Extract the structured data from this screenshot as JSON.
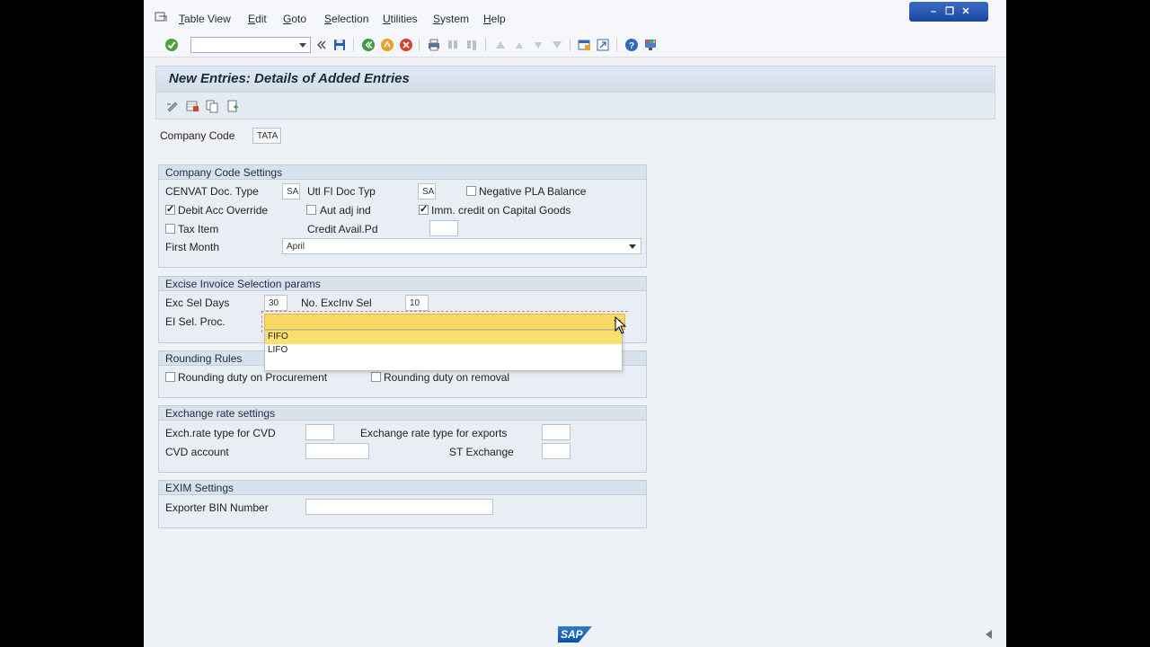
{
  "menubar": {
    "items": [
      "Table View",
      "Edit",
      "Goto",
      "Selection",
      "Utilities",
      "System",
      "Help"
    ]
  },
  "toolbar": {
    "command_field_value": "",
    "icons": [
      "enter-icon",
      "back-double-icon",
      "save-icon",
      "back-icon",
      "exit-icon",
      "cancel-icon",
      "print-icon",
      "find-icon",
      "find-next-icon",
      "first-page-icon",
      "prev-page-icon",
      "next-page-icon",
      "last-page-icon",
      "create-session-icon",
      "shortcut-icon",
      "help-icon",
      "customize-layout-icon"
    ]
  },
  "page": {
    "title": "New Entries: Details of Added Entries"
  },
  "company_code": {
    "label": "Company Code",
    "value": "TATA"
  },
  "company_settings": {
    "title": "Company Code Settings",
    "cenvat_doc_type_label": "CENVAT Doc. Type",
    "cenvat_doc_type_value": "SA",
    "utl_fi_doc_typ_label": "Utl FI Doc Typ",
    "utl_fi_doc_typ_value": "SA",
    "negative_pla_label": "Negative PLA Balance",
    "negative_pla_checked": false,
    "debit_acc_label": "Debit Acc Override",
    "debit_acc_checked": true,
    "aut_adj_label": "Aut adj ind",
    "aut_adj_checked": false,
    "imm_credit_label": "Imm. credit on Capital Goods",
    "imm_credit_checked": true,
    "tax_item_label": "Tax Item",
    "tax_item_checked": false,
    "credit_avail_label": "Credit Avail.Pd",
    "credit_avail_value": "",
    "first_month_label": "First Month",
    "first_month_value": "April"
  },
  "excise_params": {
    "title": "Excise Invoice Selection params",
    "exc_sel_days_label": "Exc Sel Days",
    "exc_sel_days_value": "30",
    "no_excinv_label": "No. ExcInv Sel",
    "no_excinv_value": "10",
    "ei_sel_proc_label": "EI Sel. Proc.",
    "ei_sel_proc_value": "",
    "ei_sel_proc_options": [
      "FIFO",
      "LIFO"
    ],
    "highlighted_option": "FIFO"
  },
  "rounding": {
    "title": "Rounding Rules",
    "procurement_label": "Rounding duty on Procurement",
    "removal_label": "Rounding duty on removal"
  },
  "exchange": {
    "title": "Exchange rate settings",
    "cvd_type_label": "Exch.rate type for CVD",
    "cvd_type_value": "",
    "exports_type_label": "Exchange rate type for exports",
    "exports_type_value": "",
    "cvd_account_label": "CVD account",
    "cvd_account_value": "",
    "st_exchange_label": "ST Exchange",
    "st_exchange_value": ""
  },
  "exim": {
    "title": "EXIM Settings",
    "bin_label": "Exporter BIN Number",
    "bin_value": ""
  },
  "footer": {
    "logo_text": "SAP"
  }
}
